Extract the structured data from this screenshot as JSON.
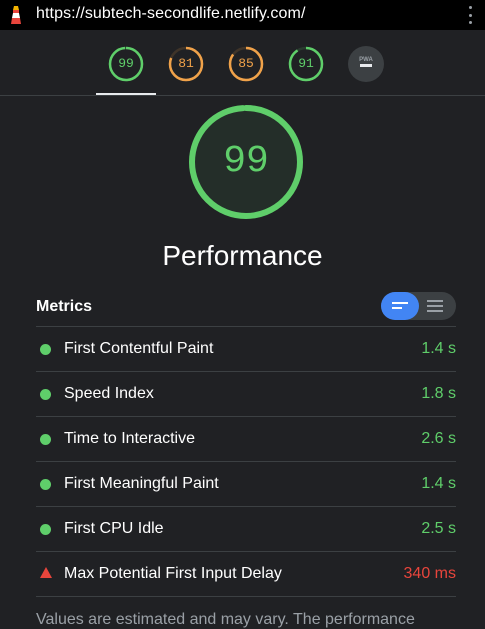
{
  "browser": {
    "url": "https://subtech-secondlife.netlify.com/",
    "logo_icon": "lighthouse-icon",
    "menu_icon": "kebab-menu-icon"
  },
  "category_gauges": [
    {
      "score": "99",
      "color": "#5fce6a",
      "fraction": 0.99
    },
    {
      "score": "81",
      "color": "#f0a24a",
      "fraction": 0.81
    },
    {
      "score": "85",
      "color": "#f0a24a",
      "fraction": 0.85
    },
    {
      "score": "91",
      "color": "#5fce6a",
      "fraction": 0.91
    },
    {
      "icon": "pwa-badge-icon",
      "color": "#9aa0a6"
    }
  ],
  "main_gauge": {
    "score": "99",
    "color": "#5fce6a",
    "fraction": 0.99
  },
  "category_title": "Performance",
  "metrics": {
    "label": "Metrics",
    "toggle": {
      "active": "compact",
      "icons": [
        "compact-view-icon",
        "expanded-view-icon"
      ]
    },
    "rows": [
      {
        "name": "First Contentful Paint",
        "value": "1.4 s",
        "status": "pass",
        "color": "#5fce6a"
      },
      {
        "name": "Speed Index",
        "value": "1.8 s",
        "status": "pass",
        "color": "#5fce6a"
      },
      {
        "name": "Time to Interactive",
        "value": "2.6 s",
        "status": "pass",
        "color": "#5fce6a"
      },
      {
        "name": "First Meaningful Paint",
        "value": "1.4 s",
        "status": "pass",
        "color": "#5fce6a"
      },
      {
        "name": "First CPU Idle",
        "value": "2.5 s",
        "status": "pass",
        "color": "#5fce6a"
      },
      {
        "name": "Max Potential First Input Delay",
        "value": "340 ms",
        "status": "fail",
        "color": "#e8453c"
      }
    ]
  },
  "footer_note": "Values are estimated and may vary. The performance"
}
